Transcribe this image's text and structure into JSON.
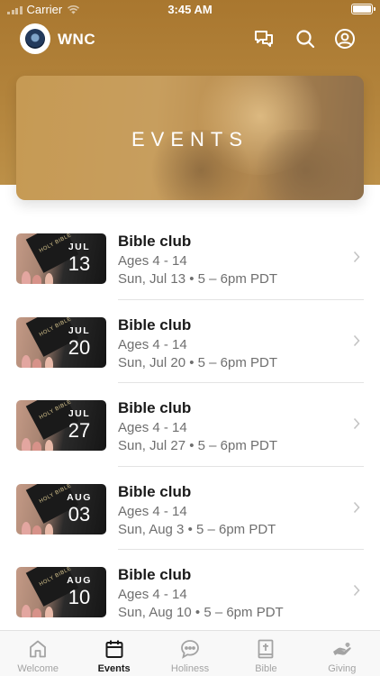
{
  "status_bar": {
    "carrier": "Carrier",
    "time": "3:45 AM"
  },
  "app": {
    "title": "WNC",
    "accent": "#b08039"
  },
  "top_icons": [
    "chat-icon",
    "search-icon",
    "profile-icon"
  ],
  "hero": {
    "title": "EVENTS"
  },
  "events": [
    {
      "title": "Bible club",
      "ages": "Ages 4 - 14",
      "when": "Sun, Jul 13 • 5 – 6pm PDT",
      "month": "JUL",
      "day": "13",
      "book_text": "HOLY BIBLE"
    },
    {
      "title": "Bible club",
      "ages": "Ages 4 - 14",
      "when": "Sun, Jul 20 • 5 – 6pm PDT",
      "month": "JUL",
      "day": "20",
      "book_text": "HOLY BIBLE"
    },
    {
      "title": "Bible club",
      "ages": "Ages 4 - 14",
      "when": "Sun, Jul 27 • 5 – 6pm PDT",
      "month": "JUL",
      "day": "27",
      "book_text": "HOLY BIBLE"
    },
    {
      "title": "Bible club",
      "ages": "Ages 4 - 14",
      "when": "Sun, Aug 3 • 5 – 6pm PDT",
      "month": "AUG",
      "day": "03",
      "book_text": "HOLY BIBLE"
    },
    {
      "title": "Bible club",
      "ages": "Ages 4 - 14",
      "when": "Sun, Aug 10 • 5 – 6pm PDT",
      "month": "AUG",
      "day": "10",
      "book_text": "HOLY BIBLE"
    }
  ],
  "tabs": [
    {
      "label": "Welcome",
      "icon": "home-icon",
      "active": false
    },
    {
      "label": "Events",
      "icon": "calendar-icon",
      "active": true
    },
    {
      "label": "Holiness",
      "icon": "speech-bubble-icon",
      "active": false
    },
    {
      "label": "Bible",
      "icon": "bible-icon",
      "active": false
    },
    {
      "label": "Giving",
      "icon": "giving-hand-icon",
      "active": false
    }
  ]
}
